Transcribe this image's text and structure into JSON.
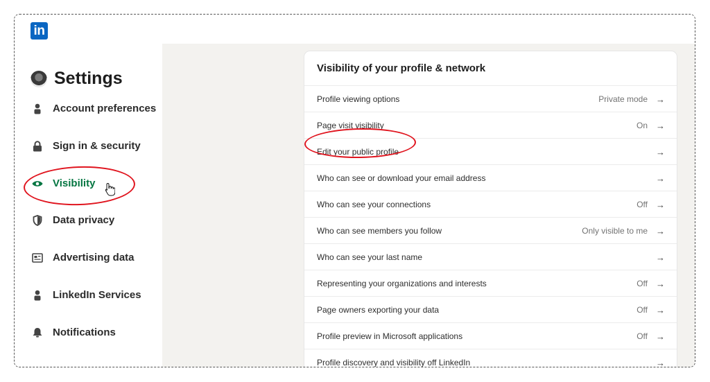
{
  "sidebar": {
    "title": "Settings",
    "items": [
      {
        "label": "Account preferences",
        "icon": "person-icon"
      },
      {
        "label": "Sign in & security",
        "icon": "lock-icon"
      },
      {
        "label": "Visibility",
        "icon": "eye-icon",
        "active": true
      },
      {
        "label": "Data privacy",
        "icon": "shield-icon"
      },
      {
        "label": "Advertising data",
        "icon": "newspaper-icon"
      },
      {
        "label": "LinkedIn Services",
        "icon": "person-icon"
      },
      {
        "label": "Notifications",
        "icon": "bell-icon"
      }
    ]
  },
  "logo": {
    "text": "in"
  },
  "card": {
    "title": "Visibility of your profile & network",
    "rows": [
      {
        "label": "Profile viewing options",
        "value": "Private mode"
      },
      {
        "label": "Page visit visibility",
        "value": "On"
      },
      {
        "label": "Edit your public profile",
        "value": ""
      },
      {
        "label": "Who can see or download your email address",
        "value": ""
      },
      {
        "label": "Who can see your connections",
        "value": "Off"
      },
      {
        "label": "Who can see members you follow",
        "value": "Only visible to me"
      },
      {
        "label": "Who can see your last name",
        "value": ""
      },
      {
        "label": "Representing your organizations and interests",
        "value": "Off"
      },
      {
        "label": "Page owners exporting your data",
        "value": "Off"
      },
      {
        "label": "Profile preview in Microsoft applications",
        "value": "Off"
      },
      {
        "label": "Profile discovery and visibility off LinkedIn",
        "value": ""
      }
    ]
  },
  "colors": {
    "brand": "#0a66c2",
    "active": "#057642",
    "annotation": "#e0141e"
  }
}
